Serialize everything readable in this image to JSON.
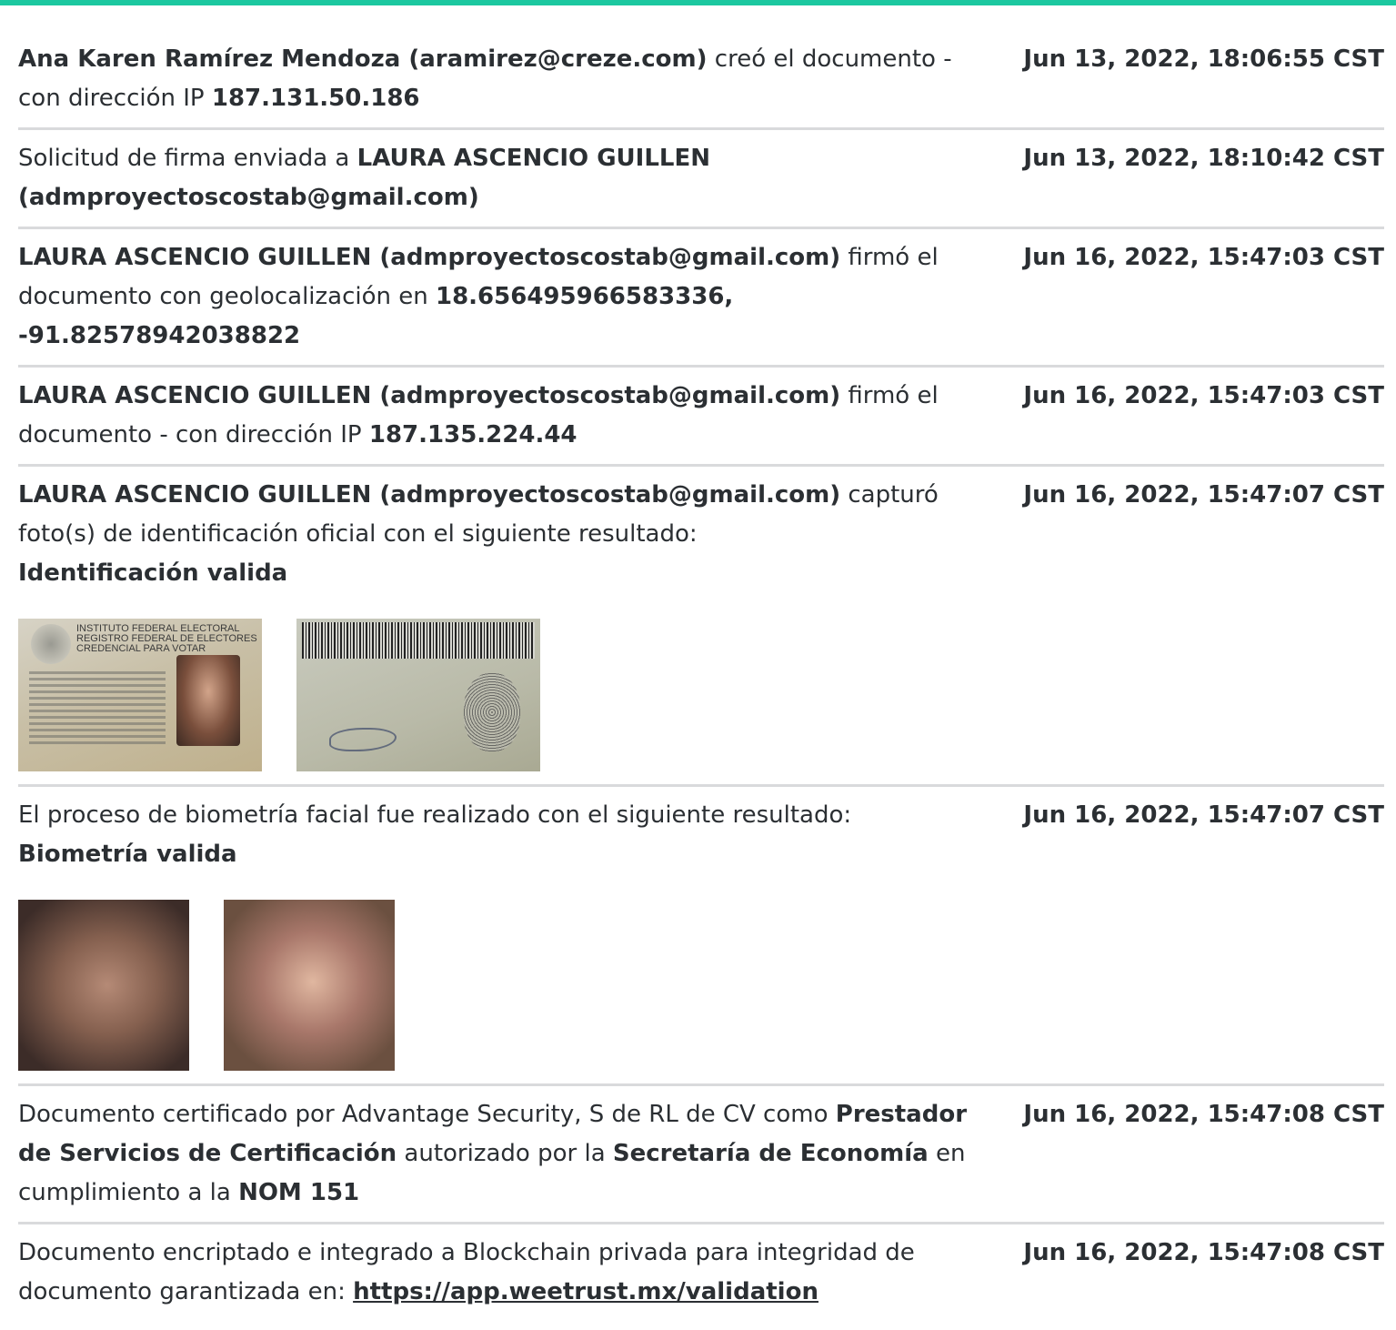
{
  "entries": [
    {
      "segments": [
        {
          "t": "Ana Karen Ramírez Mendoza (aramirez@creze.com)",
          "b": true
        },
        {
          "t": " creó el documento - con dirección IP ",
          "b": false
        },
        {
          "t": "187.131.50.186",
          "b": true
        }
      ],
      "timestamp": "Jun 13, 2022, 18:06:55 CST"
    },
    {
      "segments": [
        {
          "t": "Solicitud de firma enviada a ",
          "b": false
        },
        {
          "t": "LAURA ASCENCIO GUILLEN (admproyectoscostab@gmail.com)",
          "b": true
        }
      ],
      "timestamp": "Jun 13, 2022, 18:10:42 CST"
    },
    {
      "segments": [
        {
          "t": "LAURA ASCENCIO GUILLEN (admproyectoscostab@gmail.com)",
          "b": true
        },
        {
          "t": " firmó el documento con geolocalización en ",
          "b": false
        },
        {
          "t": "18.656495966583336, -91.82578942038822",
          "b": true
        }
      ],
      "timestamp": "Jun 16, 2022, 15:47:03 CST"
    },
    {
      "segments": [
        {
          "t": "LAURA ASCENCIO GUILLEN (admproyectoscostab@gmail.com)",
          "b": true
        },
        {
          "t": " firmó el documento - con dirección IP ",
          "b": false
        },
        {
          "t": "187.135.224.44",
          "b": true
        }
      ],
      "timestamp": "Jun 16, 2022, 15:47:03 CST"
    },
    {
      "segments": [
        {
          "t": "LAURA ASCENCIO GUILLEN (admproyectoscostab@gmail.com)",
          "b": true
        },
        {
          "t": " capturó foto(s) de identificación oficial con el siguiente resultado:",
          "b": false
        },
        {
          "t": "Identificación valida",
          "b": true,
          "br": true
        }
      ],
      "timestamp": "Jun 16, 2022, 15:47:07 CST",
      "images": "id"
    },
    {
      "segments": [
        {
          "t": "El proceso de biometría facial fue realizado con el siguiente resultado:",
          "b": false
        },
        {
          "t": "Biometría valida",
          "b": true,
          "br": true
        }
      ],
      "timestamp": "Jun 16, 2022, 15:47:07 CST",
      "images": "face"
    },
    {
      "segments": [
        {
          "t": "Documento certificado por Advantage Security, S de RL de CV como ",
          "b": false
        },
        {
          "t": "Prestador de Servicios de Certificación",
          "b": true
        },
        {
          "t": " autorizado por la ",
          "b": false
        },
        {
          "t": "Secretaría de Economía",
          "b": true
        },
        {
          "t": " en cumplimiento a la ",
          "b": false
        },
        {
          "t": "NOM 151",
          "b": true
        }
      ],
      "timestamp": "Jun 16, 2022, 15:47:08 CST"
    },
    {
      "segments": [
        {
          "t": "Documento encriptado e integrado a Blockchain privada para integridad de documento garantizada en: ",
          "b": false
        },
        {
          "t": "https://app.weetrust.mx/validation",
          "link": true
        }
      ],
      "timestamp": "Jun 16, 2022, 15:47:08 CST"
    }
  ],
  "id_card": {
    "title_lines": [
      "INSTITUTO FEDERAL ELECTORAL",
      "REGISTRO FEDERAL DE ELECTORES",
      "CREDENCIAL PARA VOTAR"
    ]
  }
}
